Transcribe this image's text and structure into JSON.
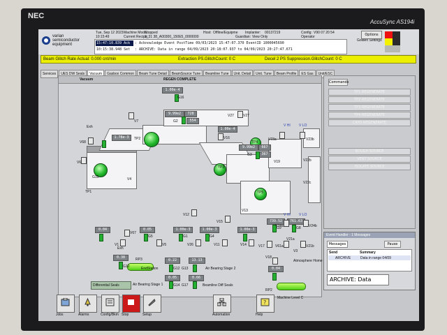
{
  "monitor": {
    "brand": "NEC",
    "model": "AccuSync AS194i"
  },
  "header": {
    "company_line1": "varian",
    "company_line2": "semiconductor",
    "company_line3": "equipment",
    "date": "Tue, Sep 12 2023",
    "time": "10:15:49",
    "machine_mode_label": "Machine Mode:",
    "machine_mode": "Stopped",
    "current_recipe_label": "Current Recipe:",
    "current_recipe": "3_31 38_A00300_150E5_0000000",
    "host_label": "Host:",
    "host": "Offline/Equipme",
    "implanter_label": "Implanter:",
    "implanter": "00137219",
    "guardian_label": "Guardian:",
    "guardian": "View Only",
    "config_label": "Config:",
    "config": "V90 07 20 54",
    "operator_label": "Operator",
    "golden_settings": "Golden Settings",
    "options": "Options"
  },
  "events": [
    {
      "time": "15:47:10.839 Ack",
      "text": ": Acknowledge Event PostTime 09/03/2023 15:47:07.370 EventID 1000045690"
    },
    {
      "time": "10:15:38.948 Set",
      "text": ": ARCHIVE: Data in range 04/09/2023 20:18:07.937 to 04/09/2023 20:27:47.671"
    }
  ],
  "status_bar": {
    "glitch_rate": "Beam Glitch Rate Actual: 0.000 cnt/min",
    "extraction": "Extraction PS.GlitchCount: 0 C",
    "decel": "Decel 2 PS Suppression.GlitchCount: 0 C"
  },
  "tabs": [
    "Services",
    "UES DW Seals",
    "Vacuum",
    "Gasbox Common",
    "Beam Tune Detail",
    "BeamSource Tune",
    "Beamline Tune",
    "Unit. Detail",
    "Unit. Tune",
    "Beam Profile",
    "ES Gas",
    "Unit/ESC"
  ],
  "active_tab": "Vacuum",
  "diagram": {
    "title": "Vacuum",
    "status": "REGEN COMPLETE",
    "pressure_top": "1.00e-4",
    "readouts": {
      "top_center": "9.99e2",
      "top_center_val": "728",
      "top_center2": "554",
      "left_pump": "1.78e-3",
      "mid_right": "1.00e-4",
      "mid_right2": "9.99e2",
      "mid_right2_val": "667",
      "mid_right3": "367",
      "r1": "739.52",
      "r2": "761.63",
      "b1": "0.04",
      "b2": "0.05",
      "b3": "1.00e-3",
      "b4": "1.00e-3",
      "b5": "1.00e-3",
      "rp3": "0.38",
      "g12": "0.22",
      "g13": "13.13",
      "g14": "0.05",
      "g17": "0.66",
      "v18": "0.04"
    },
    "labels": {
      "exh1": "Exh",
      "exh2": "Exh",
      "v68": "V68",
      "v6": "V6",
      "g15": "G15",
      "v4": "V4",
      "tp1": "TP1",
      "tp2": "TP2",
      "v67": "V67",
      "v7": "V7",
      "g16": "G16",
      "v27": "V27",
      "v27b": "V27",
      "v16": "V16",
      "v19": "V19",
      "v23a": "V23a",
      "v23b": "V23b",
      "v22b": "V22b",
      "v22c": "V22c",
      "vhi": "V HI",
      "vlo": "V LO",
      "vhi2": "V HI",
      "vlo2": "V LO",
      "v12": "V12",
      "v15": "V15",
      "v13": "V13",
      "v24a": "V24a",
      "v24b": "V24b",
      "g9": "G9",
      "g8": "G8",
      "g2": "G2",
      "g3": "G3",
      "g5": "G5",
      "g1": "G1",
      "g4": "G4",
      "v5": "V5",
      "v26": "V26",
      "v11": "V11",
      "v14": "V14",
      "v17": "V17",
      "v61": "V61a",
      "v21a": "V21a",
      "v21b": "V21b",
      "v3": "V3",
      "v1": "V1",
      "g10": "G10",
      "rp3_name": "RP3",
      "endstation": "EndStation",
      "g12_lbl": "G12",
      "g13_lbl": "G13",
      "air_bearing2": "Air Bearing Stage 2",
      "air_bearing1": "Air Bearing Stage 1",
      "g14_lbl": "G14",
      "g17_lbl": "G17",
      "beamline_diff": "Beamline Diff Seals",
      "v18_lbl": "V18",
      "atm_home": "Atmosphere Home",
      "rp2": "RP2",
      "diff_seals": "Differential Seals",
      "tp3": "TP3",
      "tp4": "TP4",
      "tp5": "TP5"
    }
  },
  "commands": {
    "title": "Commands",
    "buttons": [
      "TP1 REGENERATE",
      "TP2 REGENERATE",
      "TP3 REGENERATE",
      "TP4 REGENERATE",
      "CRYO REGENERATE",
      "",
      "ROUGH SOURCE",
      "VENT SOURCE",
      "ISOLATE SOURCE"
    ]
  },
  "event_handler": {
    "title": "Event Handler - 1 Messages",
    "tab_messages": "Messages",
    "pause": "Pause",
    "col_send": "Send",
    "col_summary": "Summary",
    "row_name": "ARCHIVE",
    "row_summary": "Data in range 04/09",
    "status_text": "ARCHIVE: Data"
  },
  "toolbar": {
    "jobs": "Jobs",
    "alarms": "Alarms",
    "config": "Config/Bkm",
    "stop": "Stop",
    "setup": "Setup",
    "automation": "Automation",
    "help": "Help",
    "machine_level": "Machine Level C"
  }
}
